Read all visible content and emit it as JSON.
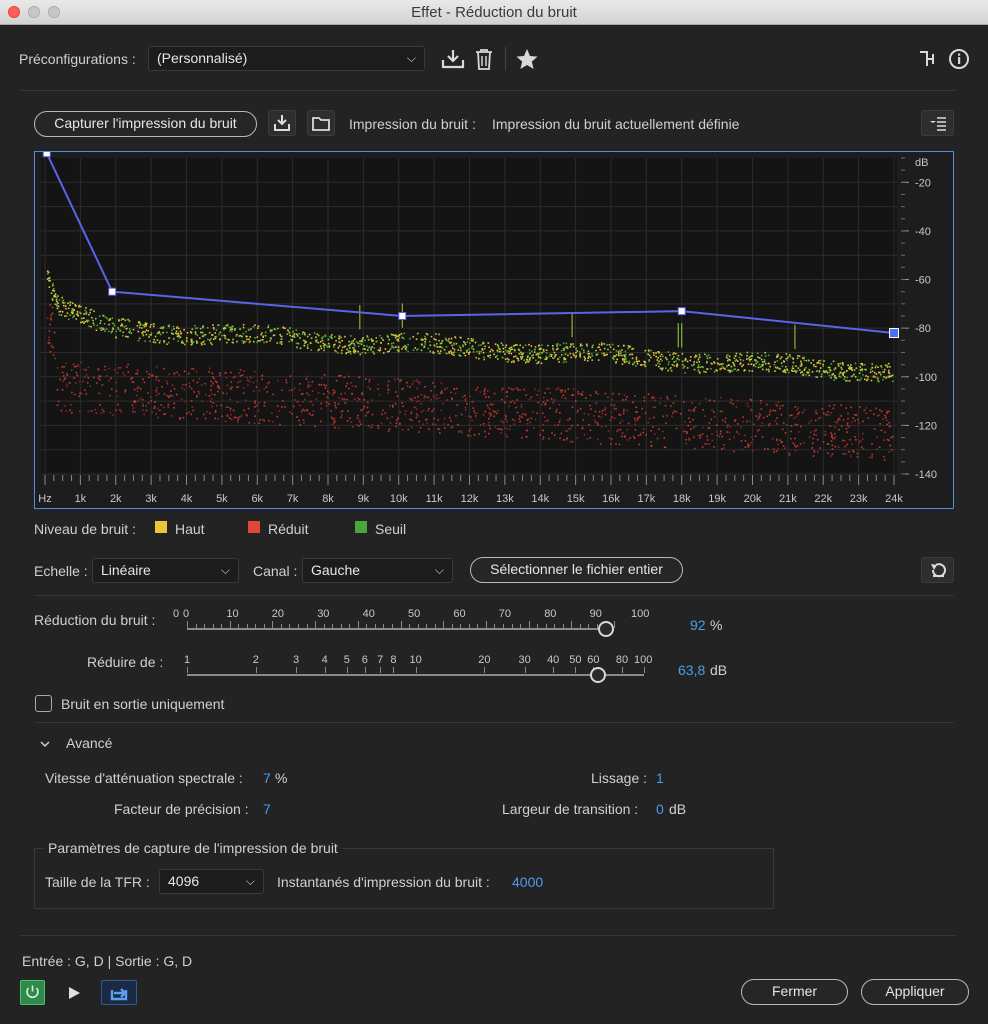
{
  "window": {
    "title": "Effet - Réduction du bruit"
  },
  "presets": {
    "label": "Préconfigurations :",
    "value": "(Personnalisé)"
  },
  "capture": {
    "button": "Capturer l'impression du bruit",
    "print_label": "Impression du bruit :",
    "print_value": "Impression du bruit actuellement définie"
  },
  "graph": {
    "db_label": "dB",
    "db_ticks": [
      "-20",
      "-40",
      "-60",
      "-80",
      "-100",
      "-120",
      "-140"
    ],
    "freq_ticks": [
      "Hz",
      "1k",
      "2k",
      "3k",
      "4k",
      "5k",
      "6k",
      "7k",
      "8k",
      "9k",
      "10k",
      "11k",
      "12k",
      "13k",
      "14k",
      "15k",
      "16k",
      "17k",
      "18k",
      "19k",
      "20k",
      "21k",
      "22k",
      "23k",
      "24k"
    ]
  },
  "legend": {
    "label": "Niveau de bruit :",
    "items": [
      {
        "name": "Haut",
        "color": "#e8c53a"
      },
      {
        "name": "Réduit",
        "color": "#e0463a"
      },
      {
        "name": "Seuil",
        "color": "#4aa63a"
      }
    ]
  },
  "scale": {
    "label": "Echelle :",
    "value": "Linéaire"
  },
  "channel": {
    "label": "Canal :",
    "value": "Gauche"
  },
  "select_file_button": "Sélectionner le fichier entier",
  "noise_reduction": {
    "label": "Réduction du bruit :",
    "ticks": [
      "0",
      "0",
      "10",
      "20",
      "30",
      "40",
      "50",
      "60",
      "70",
      "80",
      "90",
      "100"
    ],
    "value": "92",
    "unit": "%",
    "level": 0.92
  },
  "reduce_by": {
    "label": "Réduire de :",
    "ticks": [
      "1",
      "2",
      "3",
      "4",
      "5",
      "6",
      "7",
      "8",
      "10",
      "20",
      "30",
      "40",
      "50",
      "60",
      "80",
      "100"
    ],
    "value": "63,8",
    "unit": "dB"
  },
  "output_noise_only": {
    "label": "Bruit en sortie uniquement",
    "checked": false
  },
  "advanced": {
    "label": "Avancé",
    "spectral_decay_label": "Vitesse d'atténuation spectrale :",
    "spectral_decay_value": "7",
    "spectral_decay_unit": "%",
    "smoothing_label": "Lissage :",
    "smoothing_value": "1",
    "precision_label": "Facteur de précision :",
    "precision_value": "7",
    "transition_label": "Largeur de transition :",
    "transition_value": "0",
    "transition_unit": "dB"
  },
  "capture_params": {
    "title": "Paramètres de capture de l'impression de bruit",
    "fft_label": "Taille de la TFR :",
    "fft_value": "4096",
    "snapshots_label": "Instantanés d'impression du bruit :",
    "snapshots_value": "4000"
  },
  "io": {
    "text": "Entrée : G, D | Sortie : G, D"
  },
  "footer": {
    "close": "Fermer",
    "apply": "Appliquer"
  }
}
